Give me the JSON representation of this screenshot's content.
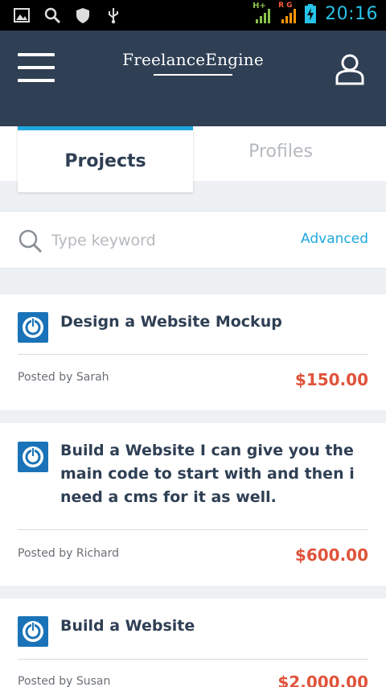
{
  "status_bar": {
    "left_icons": [
      "image-icon",
      "search-icon",
      "shield-icon",
      "usb-icon"
    ],
    "network_label_1": "H+",
    "network_label_2": "R G",
    "clock": "20:16",
    "colors": {
      "signal_1": "#8bc34a",
      "signal_2": "#ff9800",
      "battery": "#27c3e8"
    }
  },
  "header": {
    "brand": "FreelanceEngine",
    "background": "#2f3f54"
  },
  "tabs": [
    {
      "label": "Projects",
      "active": true
    },
    {
      "label": "Profiles",
      "active": false
    }
  ],
  "search": {
    "placeholder": "Type keyword",
    "advanced_label": "Advanced"
  },
  "projects": [
    {
      "title": "Design a Website Mockup",
      "posted_by": "Posted by Sarah",
      "price": "$150.00"
    },
    {
      "title": "Build a Website I can give you the main code to start with and then i need a cms for it as well.",
      "posted_by": "Posted by Richard",
      "price": "$600.00"
    },
    {
      "title": "Build a Website",
      "posted_by": "Posted by Susan",
      "price": "$2,000.00"
    }
  ],
  "colors": {
    "accent": "#1fa8e0",
    "price": "#e0533b",
    "title": "#2f3f54"
  }
}
